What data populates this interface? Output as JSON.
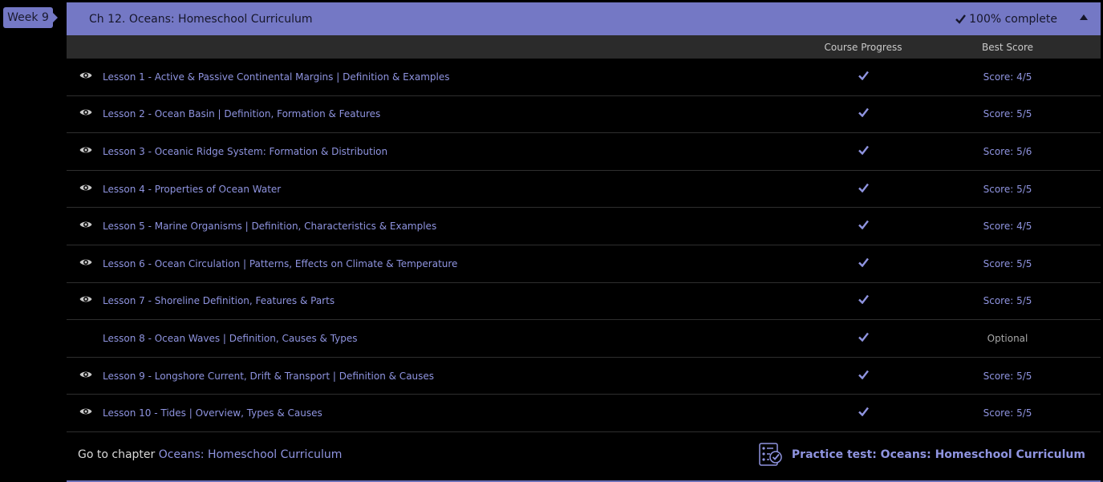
{
  "week_badge": "Week 9",
  "chapter": {
    "title": "Ch 12. Oceans: Homeschool Curriculum",
    "complete_text": "100% complete"
  },
  "columns": {
    "progress": "Course Progress",
    "score": "Best Score"
  },
  "lessons": [
    {
      "title": "Lesson 1 - Active & Passive Continental Margins | Definition & Examples",
      "score": "Score: 4/5",
      "eye": true
    },
    {
      "title": "Lesson 2 - Ocean Basin | Definition, Formation & Features",
      "score": "Score: 5/5",
      "eye": true
    },
    {
      "title": "Lesson 3 - Oceanic Ridge System: Formation & Distribution",
      "score": "Score: 5/6",
      "eye": true
    },
    {
      "title": "Lesson 4 - Properties of Ocean Water",
      "score": "Score: 5/5",
      "eye": true
    },
    {
      "title": "Lesson 5 - Marine Organisms | Definition, Characteristics & Examples",
      "score": "Score: 4/5",
      "eye": true
    },
    {
      "title": "Lesson 6 - Ocean Circulation | Patterns, Effects on Climate & Temperature",
      "score": "Score: 5/5",
      "eye": true
    },
    {
      "title": "Lesson 7 - Shoreline Definition, Features & Parts",
      "score": "Score: 5/5",
      "eye": true
    },
    {
      "title": "Lesson 8 - Ocean Waves | Definition, Causes & Types",
      "score": "Optional",
      "eye": false
    },
    {
      "title": "Lesson 9 - Longshore Current, Drift & Transport | Definition & Causes",
      "score": "Score: 5/5",
      "eye": true
    },
    {
      "title": "Lesson 10 - Tides | Overview, Types & Causes",
      "score": "Score: 5/5",
      "eye": true
    }
  ],
  "footer": {
    "goto_prefix": "Go to chapter",
    "goto_link": "Oceans: Homeschool Curriculum",
    "practice_test": "Practice test: Oceans: Homeschool Curriculum"
  },
  "colors": {
    "accent": "#7478c5",
    "link": "#8f94e0",
    "header_bar": "#2b2b2b"
  },
  "icons": {
    "complete": "check-icon",
    "collapse": "caret-up-icon",
    "viewed": "eye-icon",
    "progress": "check-icon",
    "practice": "checklist-icon"
  }
}
